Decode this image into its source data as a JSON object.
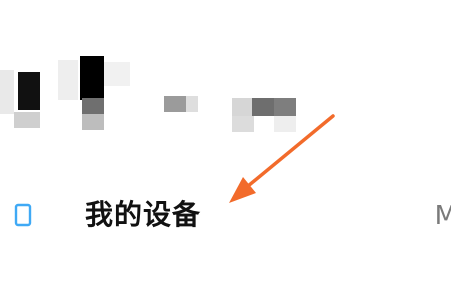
{
  "settings_row": {
    "label": "我的设备",
    "value_partial": "M",
    "icon": "device-outline-icon"
  },
  "annotation": {
    "arrow_color": "#F26B2B",
    "icon": "arrow-pointer-icon"
  },
  "colors": {
    "icon_blue": "#3FA9F5",
    "label_text": "#111111",
    "value_text": "#7A7A7A"
  }
}
